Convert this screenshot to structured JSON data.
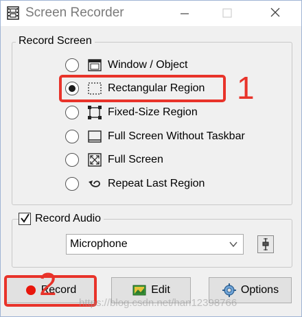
{
  "window": {
    "title": "Screen Recorder",
    "icon": "film-strip-icon",
    "controls": [
      "minimize-icon",
      "maximize-icon",
      "close-icon"
    ]
  },
  "record_screen": {
    "legend": "Record Screen",
    "options": [
      {
        "label": "Window / Object",
        "icon": "window-icon",
        "selected": false
      },
      {
        "label": "Rectangular Region",
        "icon": "dashed-rectangle-icon",
        "selected": true
      },
      {
        "label": "Fixed-Size Region",
        "icon": "fixed-region-icon",
        "selected": false
      },
      {
        "label": "Full Screen Without Taskbar",
        "icon": "screen-without-taskbar-icon",
        "selected": false
      },
      {
        "label": "Full Screen",
        "icon": "full-screen-icon",
        "selected": false
      },
      {
        "label": "Repeat Last Region",
        "icon": "repeat-arrow-icon",
        "selected": false
      }
    ]
  },
  "record_audio": {
    "label": "Record Audio",
    "checked": true,
    "source": "Microphone",
    "mixer_icon": "volume-mixer-icon"
  },
  "buttons": {
    "record": "Record",
    "edit": "Edit",
    "options": "Options"
  },
  "annotations": {
    "number_1": "1",
    "number_2": "2",
    "color": "#e8332a"
  },
  "watermark": "https://blog.csdn.net/han12398766",
  "colors": {
    "accent_red": "#e8332a",
    "record_dot": "#e8160c",
    "window_bg": "#f0f0f0"
  }
}
